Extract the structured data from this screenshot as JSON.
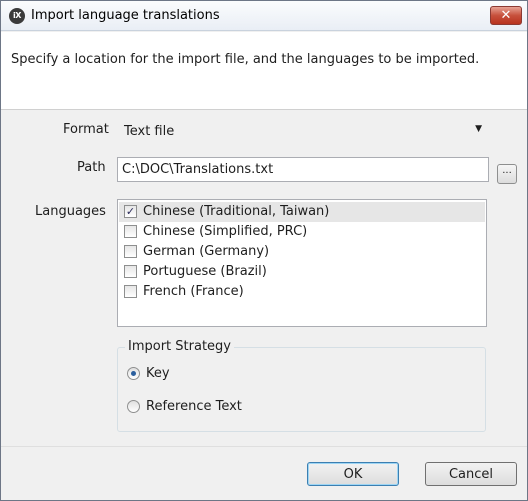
{
  "window": {
    "title": "Import language translations",
    "app_icon_text": "iX",
    "close_glyph": "✕"
  },
  "description": "Specify a location for the import file, and the languages to be imported.",
  "form": {
    "format_label": "Format",
    "format_value": "Text file",
    "path_label": "Path",
    "path_value": "C:\\DOC\\Translations.txt",
    "browse_label": "...",
    "languages_label": "Languages"
  },
  "languages": [
    {
      "label": "Chinese (Traditional, Taiwan)",
      "checked": true,
      "selected": true
    },
    {
      "label": "Chinese (Simplified, PRC)",
      "checked": false,
      "selected": false
    },
    {
      "label": "German (Germany)",
      "checked": false,
      "selected": false
    },
    {
      "label": "Portuguese (Brazil)",
      "checked": false,
      "selected": false
    },
    {
      "label": "French (France)",
      "checked": false,
      "selected": false
    }
  ],
  "import_strategy": {
    "title": "Import Strategy",
    "options": [
      {
        "label": "Key",
        "checked": true
      },
      {
        "label": "Reference Text",
        "checked": false
      }
    ]
  },
  "buttons": {
    "ok": "OK",
    "cancel": "Cancel"
  }
}
